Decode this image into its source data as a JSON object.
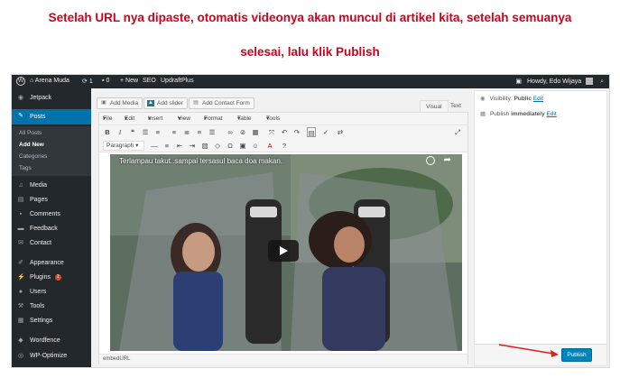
{
  "caption": {
    "line1": "Setelah URL nya dipaste, otomatis videonya akan muncul di artikel kita, setelah semuanya",
    "line2": "selesai, lalu klik Publish"
  },
  "adminbar": {
    "site_name": "Arena Muda",
    "updates_count": "1",
    "comments_count": "0",
    "new_label": "New",
    "seo_label": "SEO",
    "updraft_label": "UpdraftPlus",
    "howdy": "Howdy, Edo Wijaya"
  },
  "sidebar": {
    "items": [
      {
        "label": "Jetpack",
        "icon": "jetpack-icon"
      },
      {
        "label": "Posts",
        "icon": "pin-icon"
      },
      {
        "label": "Media",
        "icon": "media-icon"
      },
      {
        "label": "Pages",
        "icon": "page-icon"
      },
      {
        "label": "Comments",
        "icon": "comment-icon"
      },
      {
        "label": "Feedback",
        "icon": "feedback-icon"
      },
      {
        "label": "Contact",
        "icon": "mail-icon"
      },
      {
        "label": "Appearance",
        "icon": "brush-icon"
      },
      {
        "label": "Plugins",
        "icon": "plug-icon",
        "badge": "1"
      },
      {
        "label": "Users",
        "icon": "user-icon"
      },
      {
        "label": "Tools",
        "icon": "wrench-icon"
      },
      {
        "label": "Settings",
        "icon": "settings-icon"
      },
      {
        "label": "Wordfence",
        "icon": "shield-icon"
      },
      {
        "label": "WP-Optimize",
        "icon": "optimize-icon"
      }
    ],
    "submenu": [
      "All Posts",
      "Add New",
      "Categories",
      "Tags"
    ]
  },
  "editor": {
    "add_media": "Add Media",
    "add_slider": "Add slider",
    "add_contact_form": "Add Contact Form",
    "tab_visual": "Visual",
    "tab_text": "Text",
    "menus": [
      "File",
      "Edit",
      "Insert",
      "View",
      "Format",
      "Table",
      "Tools"
    ],
    "format_select": "Paragraph",
    "video_title": "Terlampau takut..sampai tersasul baca doa makan.",
    "embed_label": "embedURL"
  },
  "publish_box": {
    "visibility_label": "Visibility:",
    "visibility_value": "Public",
    "visibility_edit": "Edit",
    "publish_label": "Publish",
    "publish_value": "immediately",
    "publish_edit": "Edit",
    "publish_button": "Publish"
  },
  "colors": {
    "caption_red": "#d0021b",
    "admin_dark": "#23282d",
    "wp_blue": "#0073aa",
    "publish_blue": "#0085ba",
    "arrow_red": "#e02020"
  }
}
